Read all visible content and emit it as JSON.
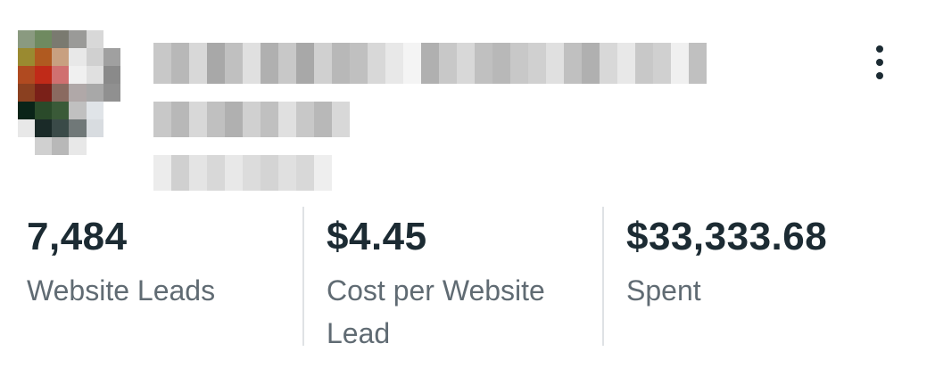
{
  "ad_card": {
    "menu_icon": "vertical-ellipsis-icon",
    "metrics": [
      {
        "value": "7,484",
        "label": "Website Leads"
      },
      {
        "value": "$4.45",
        "label": "Cost per Website Lead"
      },
      {
        "value": "$33,333.68",
        "label": "Spent"
      }
    ]
  },
  "colors": {
    "text_primary": "#1c2b33",
    "text_secondary": "#606b73",
    "divider": "#dfe2e5"
  }
}
